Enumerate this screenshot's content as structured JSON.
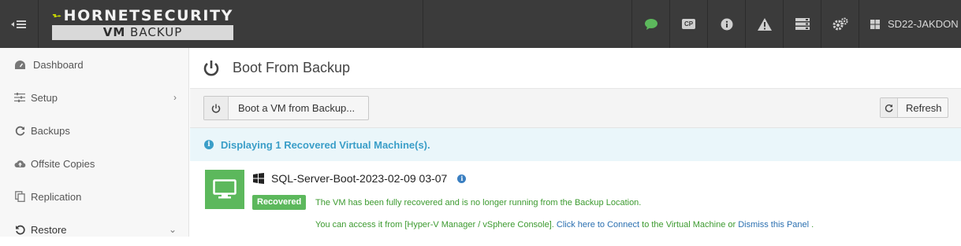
{
  "brand": {
    "name": "HORNETSECURITY",
    "product_strong": "VM",
    "product_rest": " BACKUP"
  },
  "topbar": {
    "icons": [
      "chat-icon",
      "cp-icon",
      "info-icon",
      "warning-icon",
      "server-list-icon",
      "settings-icon"
    ],
    "cp_label": "CP",
    "user": "SD22-JAKDON",
    "accent_chat": "#5cb85c"
  },
  "sidebar": {
    "items": [
      {
        "label": "Dashboard",
        "icon": "dashboard-icon"
      },
      {
        "label": "Setup",
        "icon": "sliders-icon"
      },
      {
        "label": "Backups",
        "icon": "refresh-icon"
      },
      {
        "label": "Offsite Copies",
        "icon": "cloud-upload-icon"
      },
      {
        "label": "Replication",
        "icon": "copy-icon"
      },
      {
        "label": "Restore",
        "icon": "undo-icon"
      }
    ]
  },
  "page": {
    "title": "Boot From Backup"
  },
  "toolbar": {
    "boot_label": "Boot a VM from Backup...",
    "refresh_label": "Refresh"
  },
  "info": {
    "text": "Displaying 1 Recovered Virtual Machine(s)."
  },
  "vm": {
    "name": "SQL-Server-Boot-2023-02-09 03-07",
    "status": "Recovered",
    "message": "The VM has been fully recovered and is no longer running from the Backup Location.",
    "access_prefix": "You can access it from [Hyper-V Manager / vSphere Console]. ",
    "connect_link": "Click here to Connect",
    "access_middle": " to the Virtual Machine or ",
    "dismiss_link": "Dismiss this Panel",
    "access_suffix": " ."
  },
  "colors": {
    "success": "#5cb85c",
    "info": "#3a9ec8",
    "link": "#2a6fb0",
    "topbar": "#3b3b3b"
  }
}
